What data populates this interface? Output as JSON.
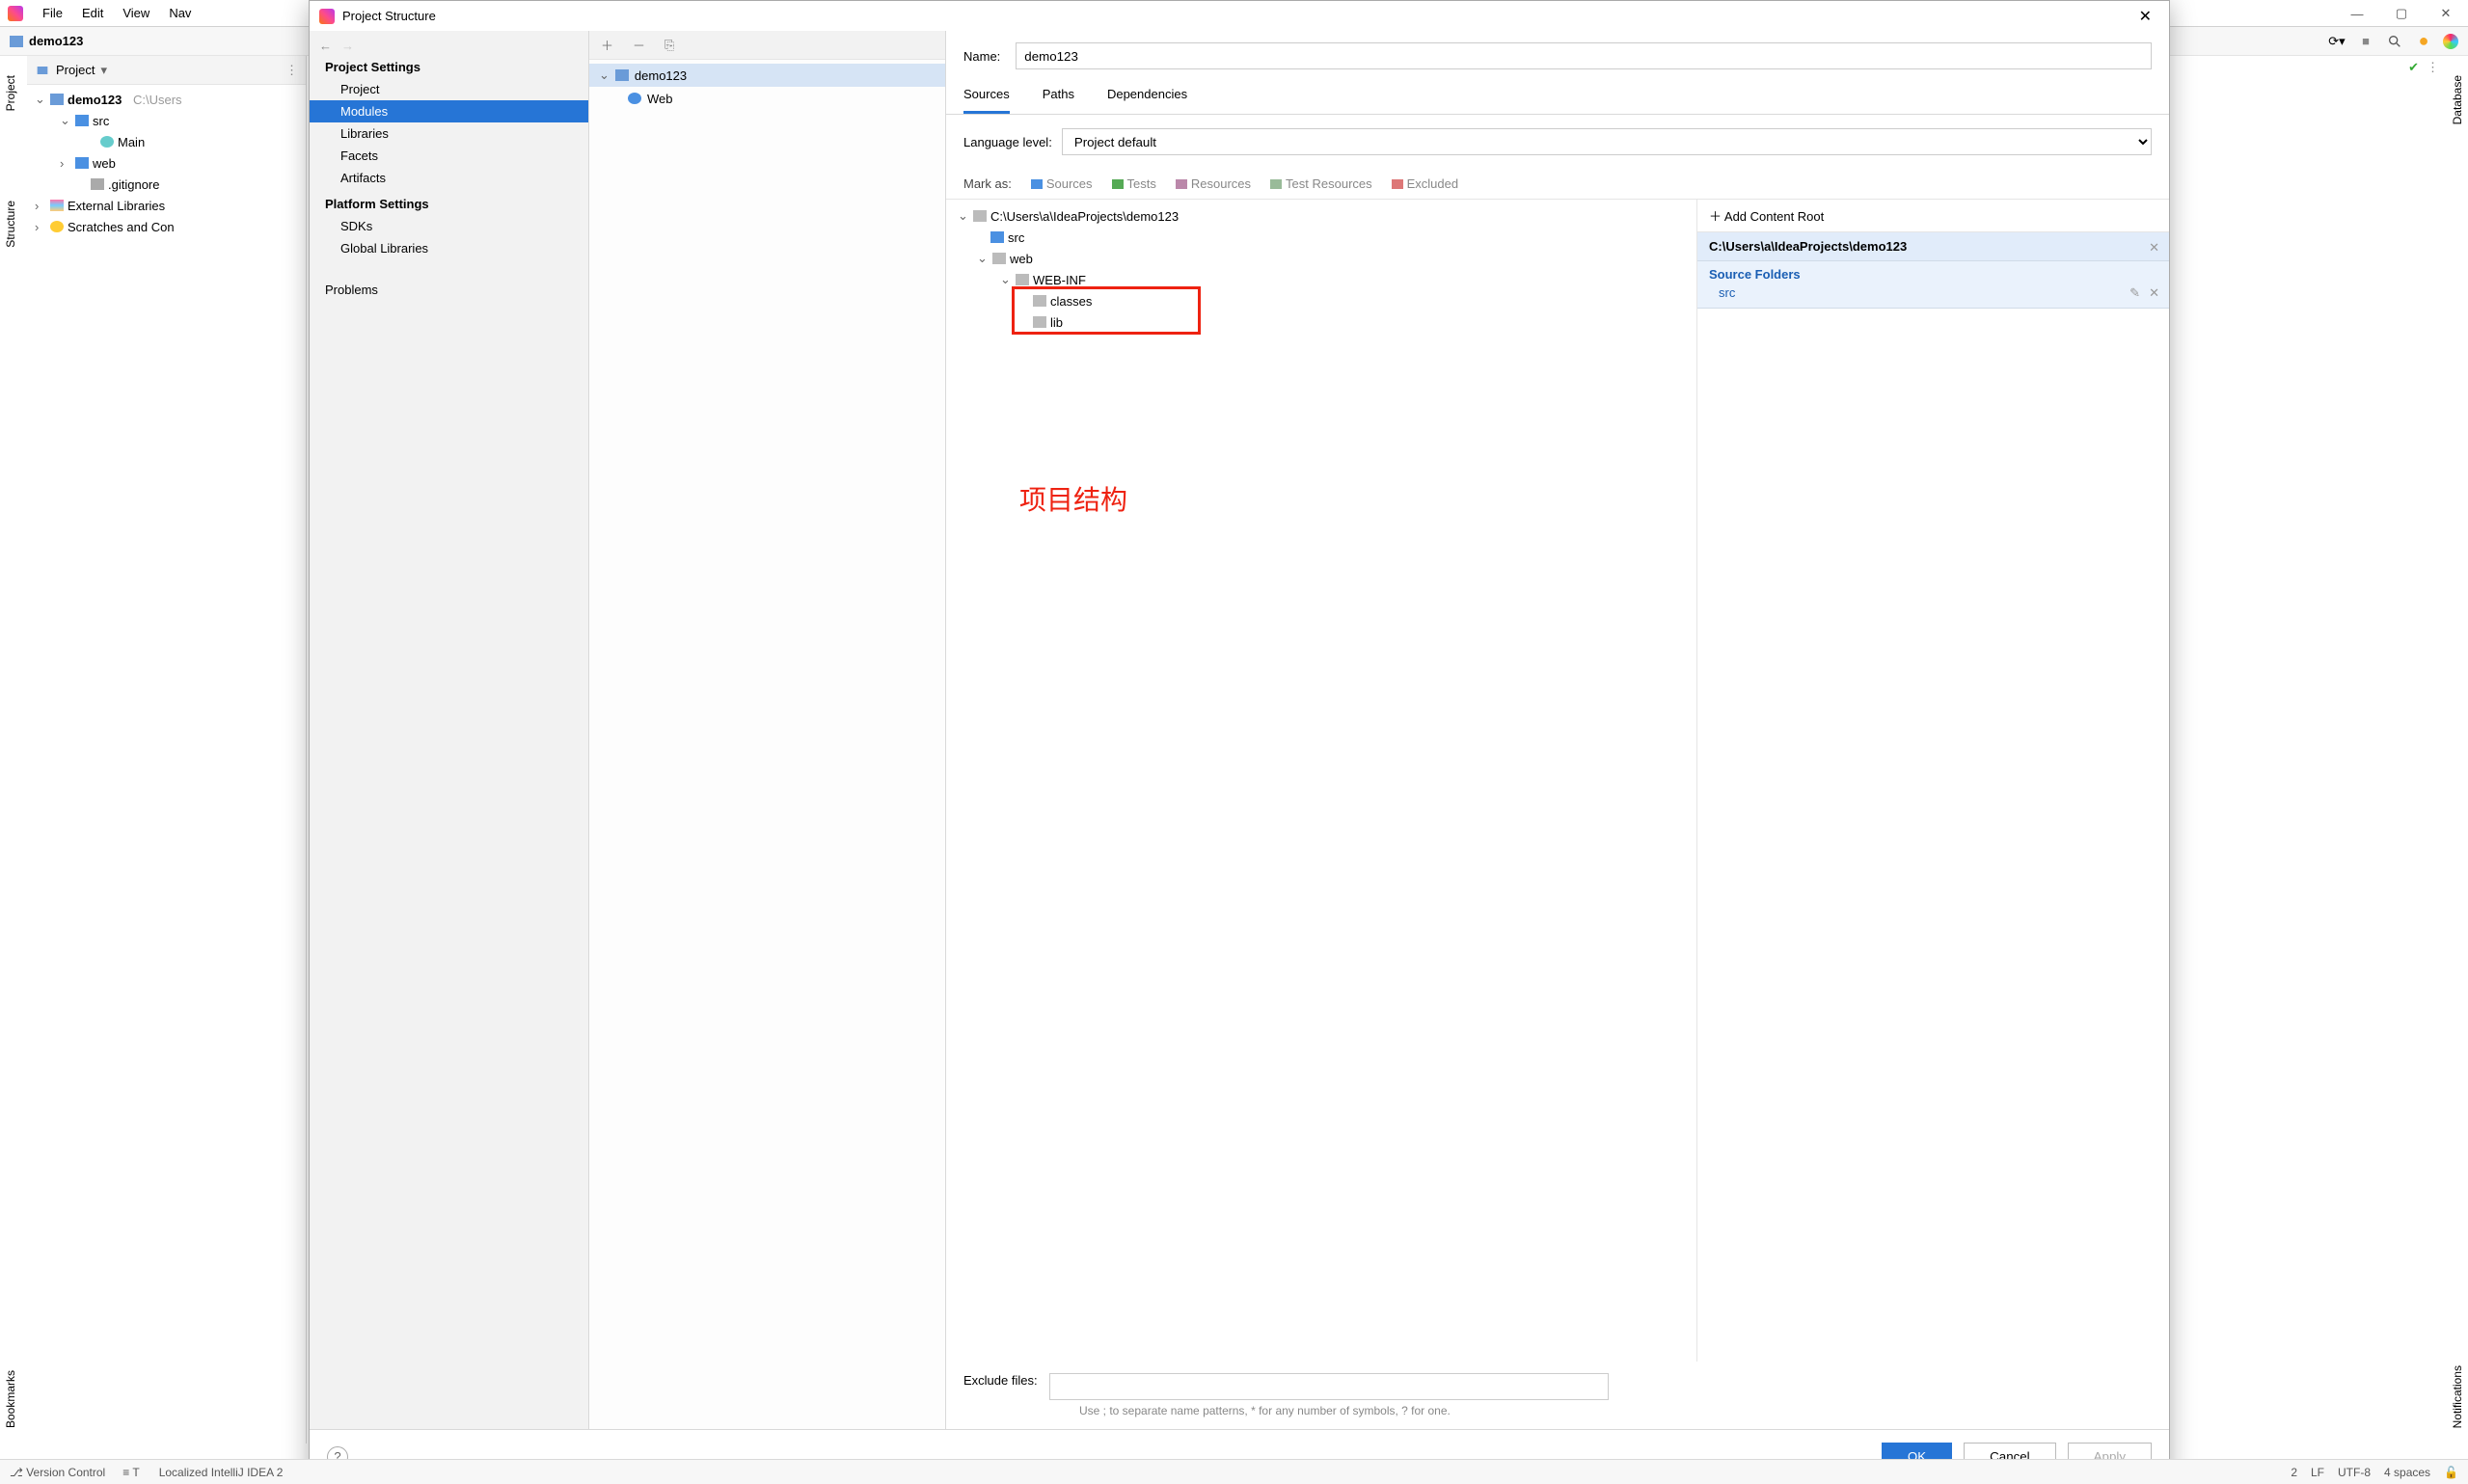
{
  "menu": {
    "items": [
      "File",
      "Edit",
      "View",
      "Nav"
    ]
  },
  "navbar": {
    "project": "demo123"
  },
  "projectPanel": {
    "title": "Project",
    "tree": {
      "root": "demo123",
      "rootPath": "C:\\Users",
      "src": "src",
      "main": "Main",
      "web": "web",
      "gitignore": ".gitignore",
      "ext": "External Libraries",
      "scratch": "Scratches and Con"
    }
  },
  "dialog": {
    "title": "Project Structure",
    "nav": {
      "groups": [
        {
          "title": "Project Settings",
          "items": [
            "Project",
            "Modules",
            "Libraries",
            "Facets",
            "Artifacts"
          ]
        },
        {
          "title": "Platform Settings",
          "items": [
            "SDKs",
            "Global Libraries"
          ]
        }
      ],
      "problems": "Problems",
      "selected": "Modules"
    },
    "modules": {
      "root": "demo123",
      "child": "Web"
    },
    "name_label": "Name:",
    "name_value": "demo123",
    "tabs": [
      "Sources",
      "Paths",
      "Dependencies"
    ],
    "lang_label": "Language level:",
    "lang_value": "Project default",
    "mark_label": "Mark as:",
    "marks": [
      "Sources",
      "Tests",
      "Resources",
      "Test Resources",
      "Excluded"
    ],
    "src_tree": {
      "root": "C:\\Users\\a\\IdeaProjects\\demo123",
      "src": "src",
      "web": "web",
      "webinf": "WEB-INF",
      "classes": "classes",
      "lib": "lib"
    },
    "annotation": "项目结构",
    "side": {
      "add": "Add Content Root",
      "path": "C:\\Users\\a\\IdeaProjects\\demo123",
      "sf_head": "Source Folders",
      "sf_item": "src"
    },
    "exclude_label": "Exclude files:",
    "exclude_help": "Use ; to separate name patterns, * for any number of symbols, ? for one.",
    "buttons": {
      "ok": "OK",
      "cancel": "Cancel",
      "apply": "Apply"
    }
  },
  "status": {
    "tabs": [
      "Version Control",
      "T"
    ],
    "msg": "Localized IntelliJ IDEA 2",
    "right": [
      "2",
      "LF",
      "UTF-8",
      "4 spaces"
    ]
  },
  "sideTabs": {
    "project": "Project",
    "structure": "Structure",
    "bookmarks": "Bookmarks",
    "notifications": "Notifications",
    "database": "Database"
  }
}
